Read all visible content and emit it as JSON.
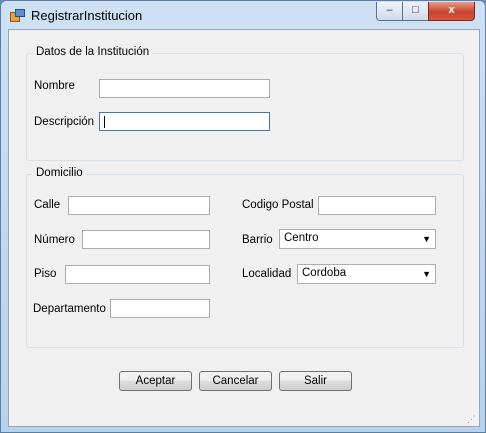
{
  "window": {
    "title": "RegistrarInstitucion",
    "controls": {
      "minimize": "–",
      "maximize": "□",
      "close": "x"
    }
  },
  "institucion": {
    "group_title": "Datos de la Institución",
    "nombre_label": "Nombre",
    "nombre_value": "",
    "descripcion_label": "Descripción",
    "descripcion_value": ""
  },
  "domicilio": {
    "group_title": "Domicilio",
    "calle_label": "Calle",
    "calle_value": "",
    "numero_label": "Número",
    "numero_value": "",
    "piso_label": "Piso",
    "piso_value": "",
    "departamento_label": "Departamento",
    "departamento_value": "",
    "codigo_postal_label": "Codigo Postal",
    "codigo_postal_value": "",
    "barrio_label": "Barrio",
    "barrio_value": "Centro",
    "localidad_label": "Localidad",
    "localidad_value": "Cordoba"
  },
  "buttons": {
    "aceptar": "Aceptar",
    "cancelar": "Cancelar",
    "salir": "Salir"
  },
  "icons": {
    "dropdown_arrow": "▼",
    "size_grip": "⋰"
  }
}
